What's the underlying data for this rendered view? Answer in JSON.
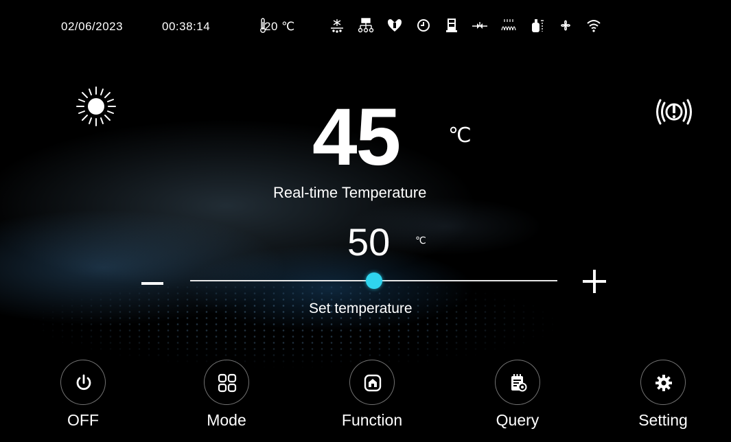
{
  "status_bar": {
    "date": "02/06/2023",
    "time": "00:38:14",
    "ambient_temp": "20 ℃",
    "icons": [
      "thermometer-icon",
      "defrost-icon",
      "network-icon",
      "heart-wrench-icon",
      "clock-icon",
      "tank-icon",
      "valve-icon",
      "heater-coil-icon",
      "compressor-icon",
      "fan-icon",
      "wifi-icon"
    ]
  },
  "mode_icon": "sun-icon",
  "alarm_icon": "alarm-icon",
  "realtime": {
    "value": "45",
    "unit": "℃",
    "label": "Real-time Temperature"
  },
  "setpoint": {
    "value": "50",
    "unit": "℃",
    "label": "Set temperature",
    "slider_fraction": 0.5
  },
  "nav": [
    {
      "label": "OFF",
      "icon": "power-icon"
    },
    {
      "label": "Mode",
      "icon": "grid-icon"
    },
    {
      "label": "Function",
      "icon": "home-icon"
    },
    {
      "label": "Query",
      "icon": "clipboard-search-icon"
    },
    {
      "label": "Setting",
      "icon": "gear-icon"
    }
  ],
  "colors": {
    "background": "#000000",
    "accent": "#2fd4ee",
    "text": "#ffffff"
  }
}
